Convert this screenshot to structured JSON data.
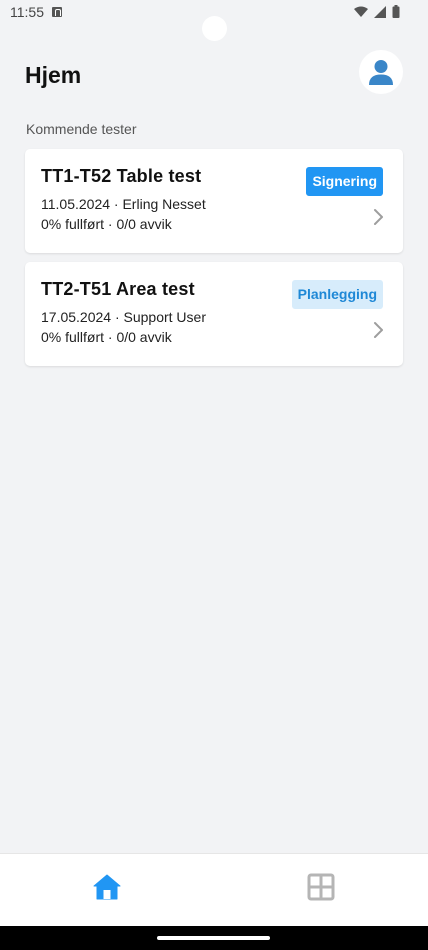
{
  "status_bar": {
    "time": "11:55"
  },
  "header": {
    "title": "Hjem"
  },
  "section": {
    "label": "Kommende tester"
  },
  "tests": [
    {
      "title": "TT1-T52 Table test",
      "meta": "11.05.2024 · Erling Nesset",
      "progress": "0% fullført · 0/0 avvik",
      "status": "Signering"
    },
    {
      "title": "TT2-T51 Area test",
      "meta": "17.05.2024 · Support User",
      "progress": "0% fullført · 0/0 avvik",
      "status": "Planlegging"
    }
  ],
  "icons": {
    "avatar": "person-icon",
    "nav_home": "home-icon",
    "nav_grid": "grid-icon",
    "chevron": "chevron-right-icon"
  },
  "colors": {
    "accent": "#2196f3",
    "badge_light_bg": "#d7ecfb",
    "badge_light_text": "#1e88d6",
    "background": "#f2f3f5"
  }
}
